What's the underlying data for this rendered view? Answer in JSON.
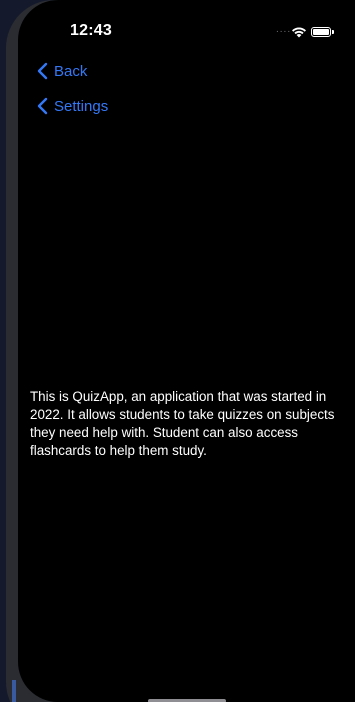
{
  "status_bar": {
    "time": "12:43",
    "signal": "....",
    "wifi_icon": "wifi-icon",
    "battery_icon": "battery-icon"
  },
  "nav": {
    "back_label": "Back",
    "settings_label": "Settings",
    "chevron_icon": "chevron-left-icon"
  },
  "content": {
    "about_text": "This is QuizApp, an application that was started in 2022. It allows students to take quizzes on subjects they need help with. Student can also access flashcards to help them study."
  },
  "colors": {
    "accent": "#3478f6",
    "background": "#000000",
    "text": "#ffffff"
  }
}
